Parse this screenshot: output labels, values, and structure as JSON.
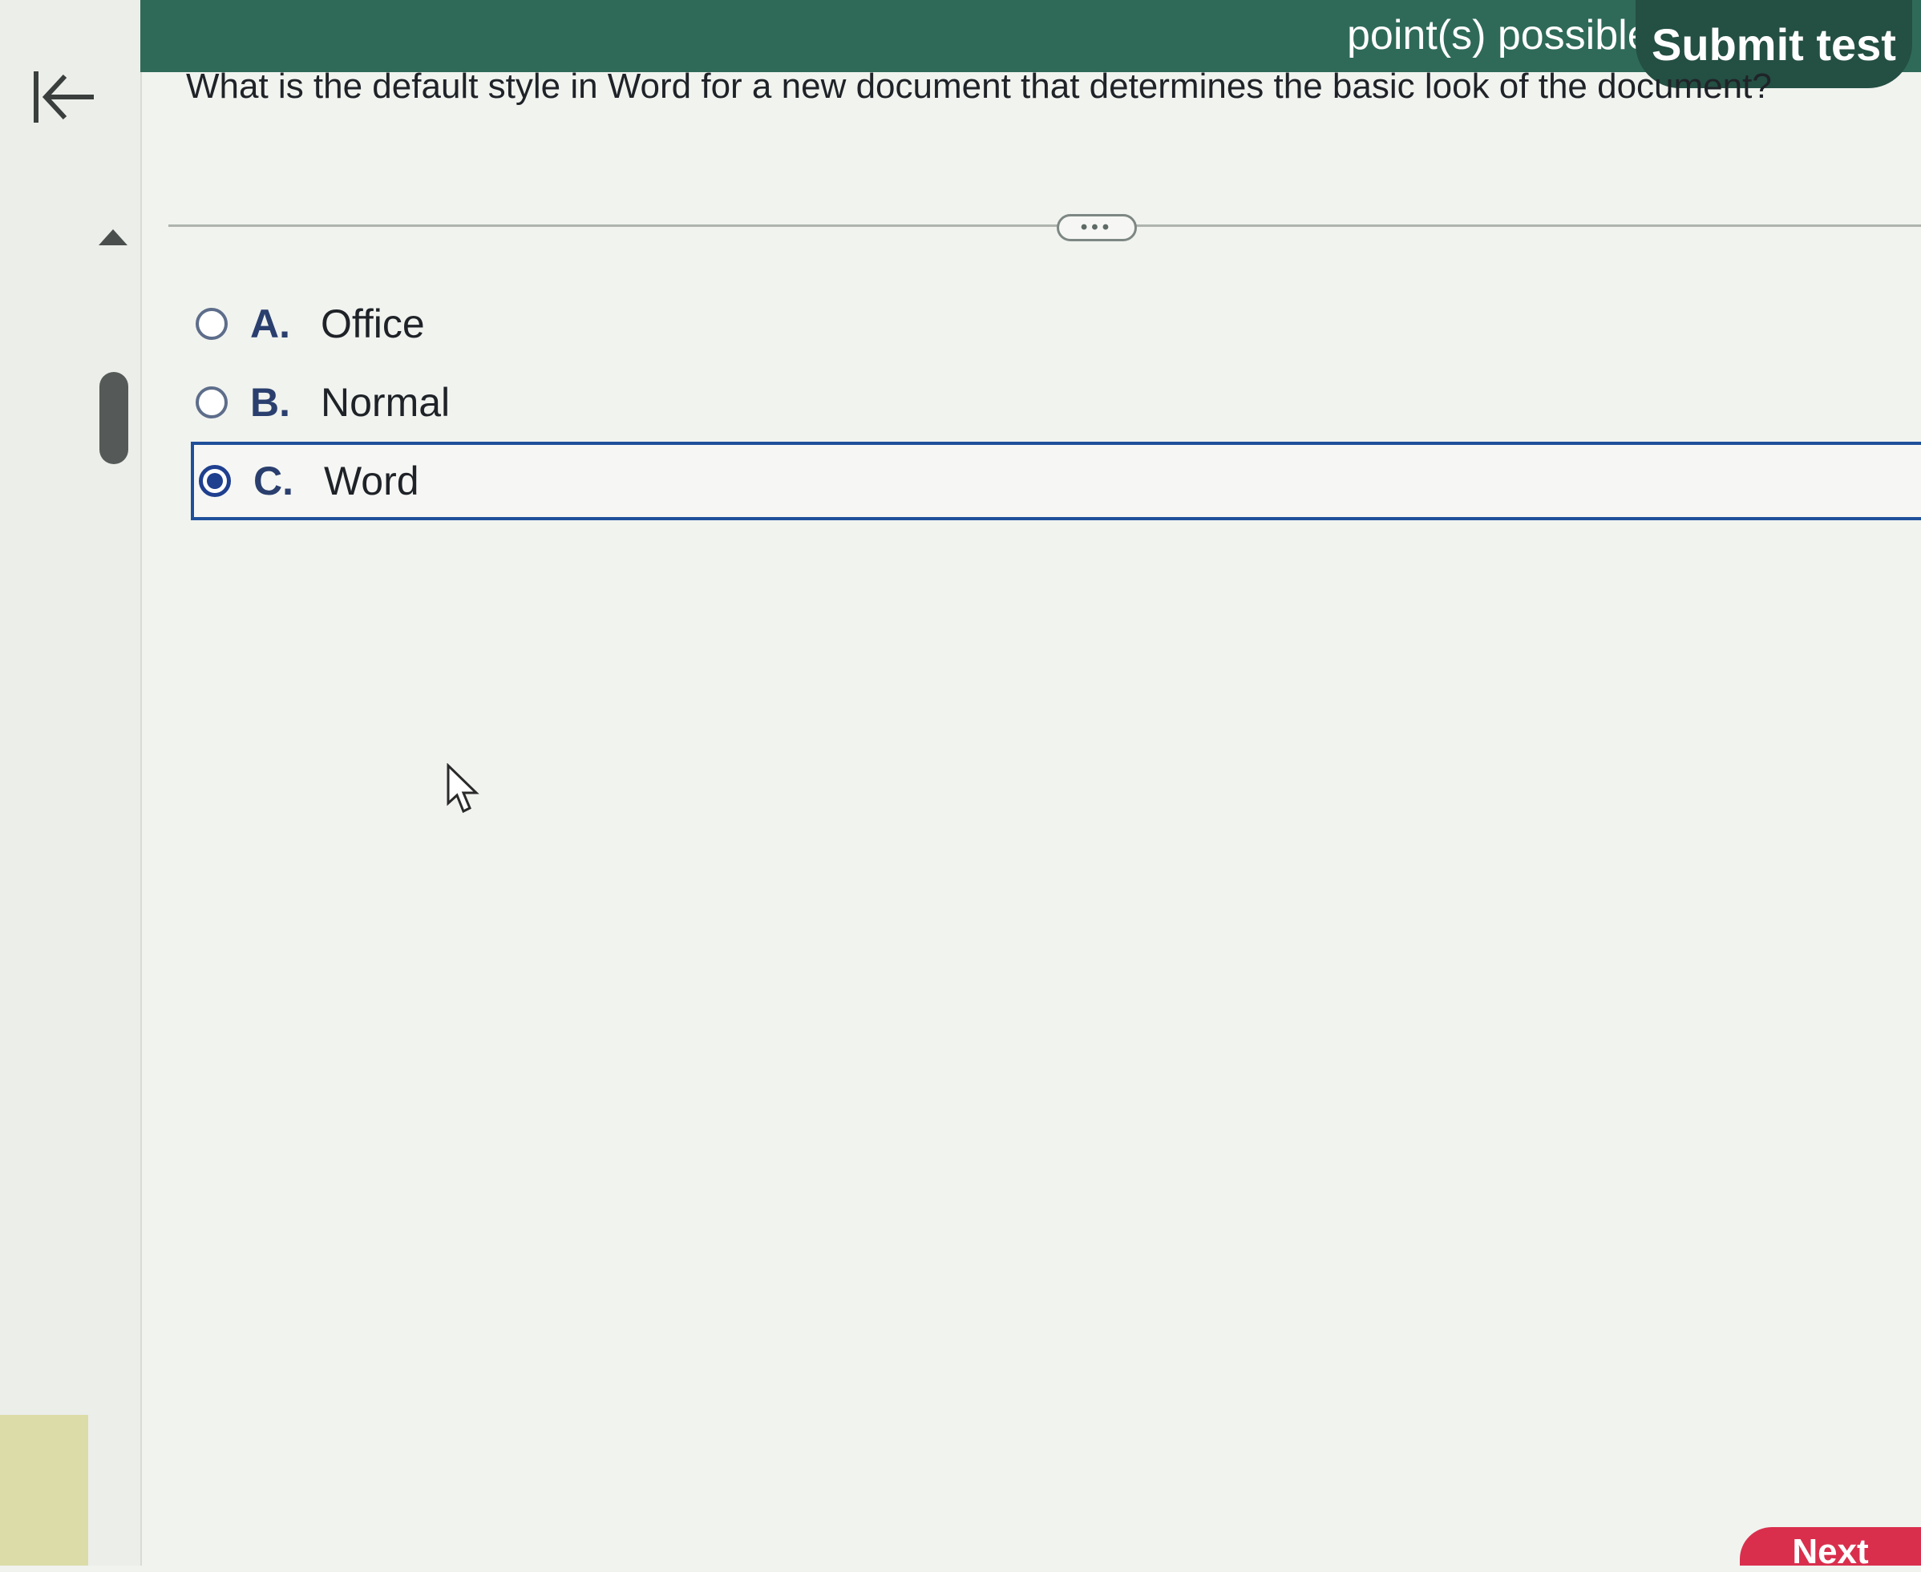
{
  "header": {
    "points_text": "point(s) possible",
    "submit_label": "Submit test"
  },
  "question": {
    "text": "What is the default style in Word for a new document that determines the basic look of the document?",
    "more_label": "•••"
  },
  "options": [
    {
      "letter": "A.",
      "label": "Office",
      "selected": false
    },
    {
      "letter": "B.",
      "label": "Normal",
      "selected": false
    },
    {
      "letter": "C.",
      "label": "Word",
      "selected": true
    }
  ],
  "footer": {
    "next_label": "Next"
  },
  "colors": {
    "header_green": "#2f6a58",
    "submit_bg": "#244f43",
    "selected_border": "#1f4f9a",
    "next_red": "#d92f4d"
  }
}
